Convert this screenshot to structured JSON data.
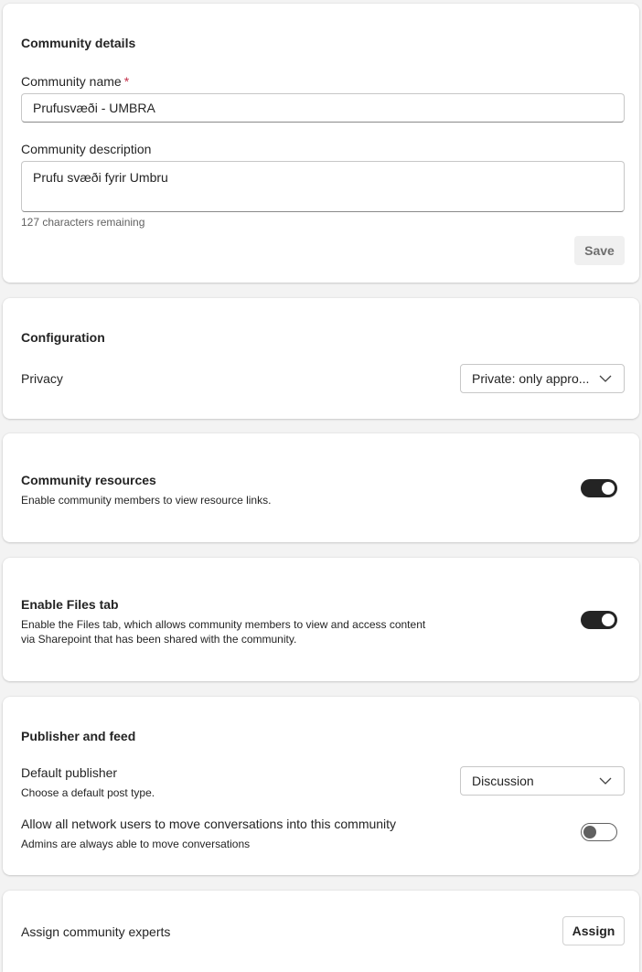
{
  "community_details": {
    "heading": "Community details",
    "name_label": "Community name",
    "required_marker": "*",
    "name_value": "Prufusvæði - UMBRA",
    "description_label": "Community description",
    "description_value": "Prufu svæði fyrir Umbru",
    "characters_remaining": "127 characters remaining",
    "save_label": "Save"
  },
  "configuration": {
    "heading": "Configuration",
    "privacy_label": "Privacy",
    "privacy_value": "Private: only appro..."
  },
  "resources": {
    "heading": "Community resources",
    "description": "Enable community members to view resource links.",
    "enabled": true
  },
  "files_tab": {
    "heading": "Enable Files tab",
    "description_line1": "Enable the Files tab, which allows community members to view and access content",
    "description_line2": "via Sharepoint that has been shared with the community.",
    "enabled": true
  },
  "publisher": {
    "heading": "Publisher and feed",
    "default_publisher_label": "Default publisher",
    "default_publisher_hint": "Choose a default post type.",
    "default_publisher_value": "Discussion",
    "move_label": "Allow all network users to move conversations into this community",
    "move_hint": "Admins are always able to move conversations",
    "move_enabled": false
  },
  "experts": {
    "label": "Assign community experts",
    "assign_label": "Assign"
  }
}
